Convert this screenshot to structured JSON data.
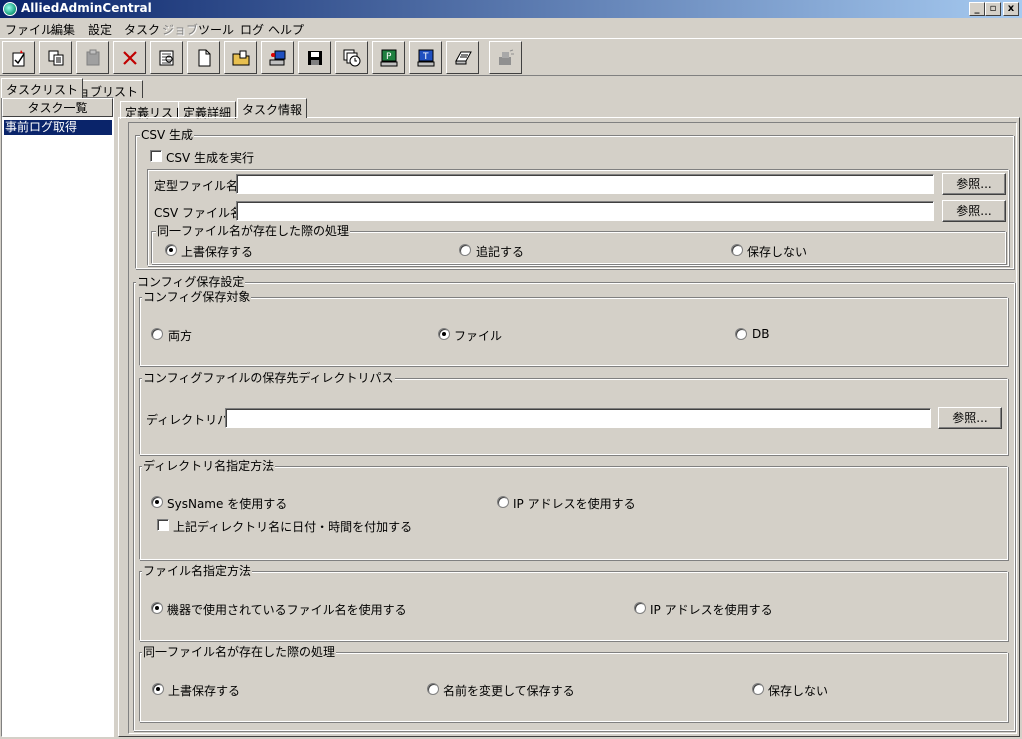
{
  "window": {
    "title": "AlliedAdminCentral",
    "controls": {
      "minimize": "_",
      "maximize": "▫",
      "close": "x"
    }
  },
  "menu": {
    "items": [
      {
        "label": "ファイル",
        "enabled": true
      },
      {
        "label": "編集",
        "enabled": true
      },
      {
        "label": "設定",
        "enabled": true
      },
      {
        "label": "タスク",
        "enabled": true
      },
      {
        "label": "ジョブ",
        "enabled": false
      },
      {
        "label": "ツール",
        "enabled": true
      },
      {
        "label": "ログ",
        "enabled": true
      },
      {
        "label": "ヘルプ",
        "enabled": true
      }
    ]
  },
  "toolbar": {
    "buttons": [
      {
        "icon": "new-task-icon"
      },
      {
        "icon": "copy-icon"
      },
      {
        "icon": "paste-icon"
      },
      {
        "icon": "delete-icon"
      },
      {
        "icon": "properties-icon"
      },
      {
        "icon": "new-document-icon"
      },
      {
        "icon": "open-folder-icon"
      },
      {
        "icon": "network-device-icon"
      },
      {
        "icon": "save-icon"
      },
      {
        "icon": "schedule-icon"
      },
      {
        "icon": "terminal-p-icon"
      },
      {
        "icon": "terminal-t-icon"
      },
      {
        "icon": "log-icon"
      },
      {
        "icon": "printer-icon"
      }
    ]
  },
  "left_tabs": [
    "タスクリスト",
    "ジョブリスト"
  ],
  "task_list": {
    "header": "タスク一覧",
    "items": [
      "事前ログ取得"
    ]
  },
  "main_tabs": [
    "定義リスト",
    "定義詳細",
    "タスク情報"
  ],
  "csv": {
    "group_title": "CSV 生成",
    "execute_label": "CSV 生成を実行",
    "template_label": "定型ファイル名:",
    "template_value": "",
    "csvfile_label": "CSV ファイル名:",
    "csvfile_value": "",
    "browse": "参照...",
    "exists_title": "同一ファイル名が存在した際の処理",
    "exists_options": [
      "上書保存する",
      "追記する",
      "保存しない"
    ]
  },
  "config": {
    "group_title": "コンフィグ保存設定",
    "target": {
      "title": "コンフィグ保存対象",
      "options": [
        "両方",
        "ファイル",
        "DB"
      ]
    },
    "dir": {
      "title": "コンフィグファイルの保存先ディレクトリパス",
      "label": "ディレクトリパス:",
      "value": "",
      "browse": "参照..."
    },
    "dirname": {
      "title": "ディレクトリ名指定方法",
      "options": [
        "SysName を使用する",
        "IP アドレスを使用する"
      ],
      "append_datetime": "上記ディレクトリ名に日付・時間を付加する"
    },
    "filename": {
      "title": "ファイル名指定方法",
      "options": [
        "機器で使用されているファイル名を使用する",
        "IP アドレスを使用する"
      ]
    },
    "exists": {
      "title": "同一ファイル名が存在した際の処理",
      "options": [
        "上書保存する",
        "名前を変更して保存する",
        "保存しない"
      ]
    }
  }
}
